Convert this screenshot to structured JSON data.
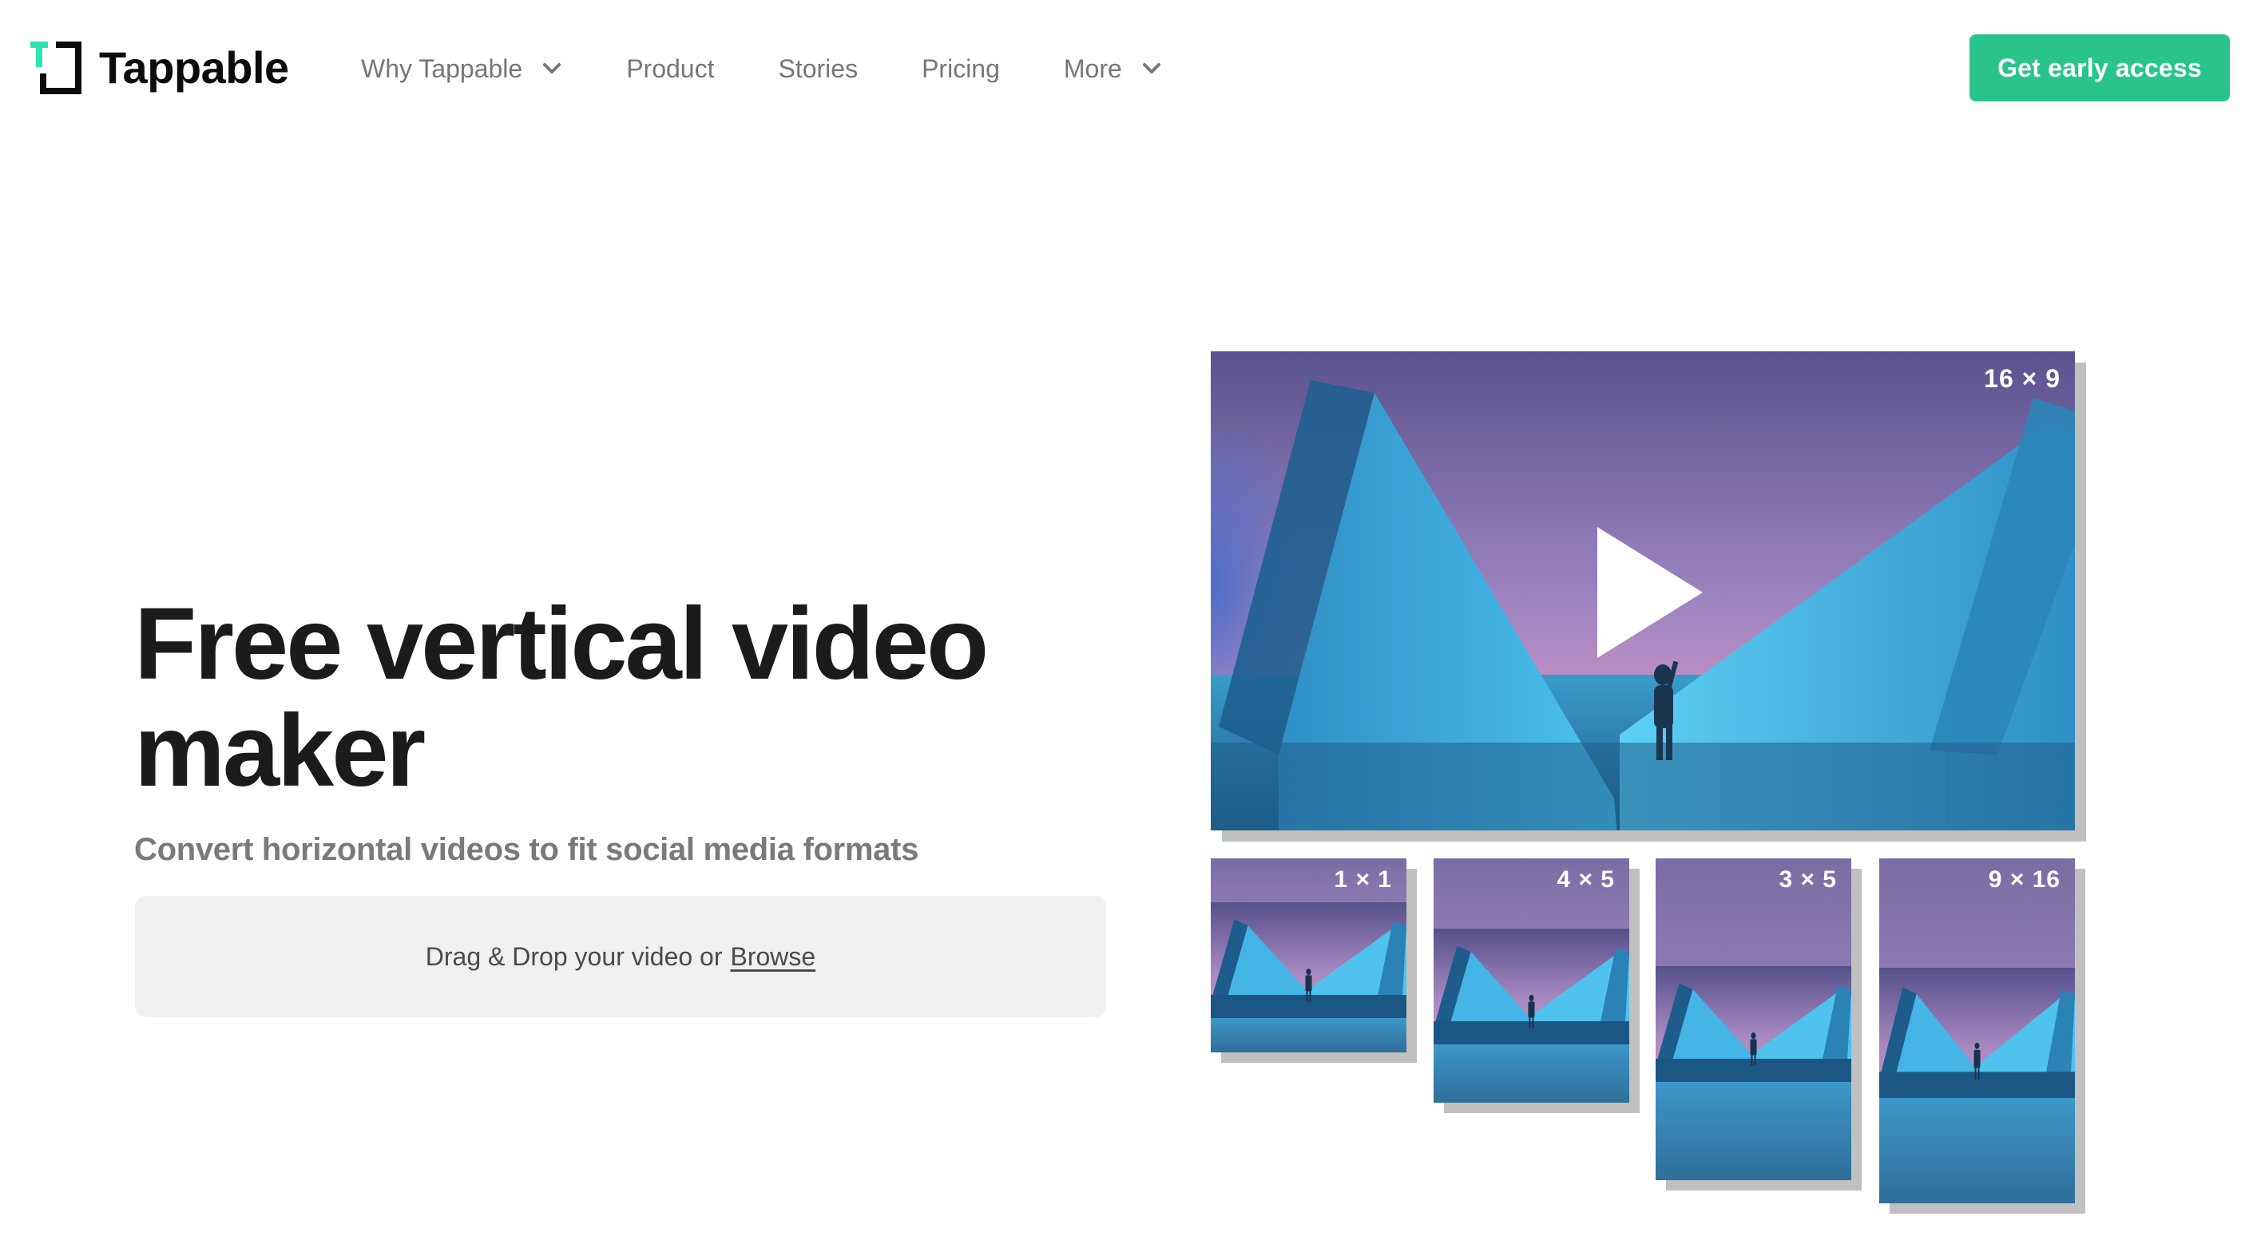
{
  "header": {
    "brand": "Tappable",
    "logo_icon": "tappable-logo-icon",
    "nav": [
      {
        "label": "Why Tappable",
        "has_dropdown": true
      },
      {
        "label": "Product",
        "has_dropdown": false
      },
      {
        "label": "Stories",
        "has_dropdown": false
      },
      {
        "label": "Pricing",
        "has_dropdown": false
      },
      {
        "label": "More",
        "has_dropdown": true
      }
    ],
    "cta_label": "Get early access"
  },
  "hero": {
    "title_line1": "Free vertical video",
    "title_line2": "maker",
    "subtitle": "Convert horizontal videos to fit social media formats",
    "dropzone": {
      "text": "Drag & Drop your video or",
      "browse_label": "Browse"
    }
  },
  "preview": {
    "main_ratio": "16 × 9",
    "play_icon": "play-icon",
    "thumbnails": [
      {
        "ratio": "1 × 1"
      },
      {
        "ratio": "4 × 5"
      },
      {
        "ratio": "3 × 5"
      },
      {
        "ratio": "9 × 16"
      }
    ]
  },
  "colors": {
    "accent": "#29c48b",
    "logo_accent": "#2fe3b1",
    "text_primary": "#1b1b1b",
    "text_muted": "#767676",
    "dropzone_bg": "#f0f0ef",
    "frame_shadow": "#bfc1c1"
  }
}
